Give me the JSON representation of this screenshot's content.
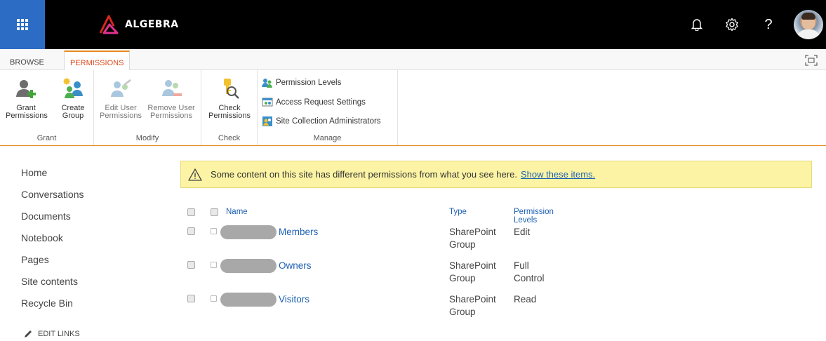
{
  "suitebar": {
    "brand": "ALGEBRA",
    "brand_colors": {
      "accent_red": "#d8281f",
      "accent_pink": "#e0328c"
    },
    "icons": [
      "waffle-icon",
      "bell-icon",
      "gear-icon",
      "help-icon",
      "avatar"
    ],
    "help_glyph": "?"
  },
  "ribbon": {
    "tabs": [
      {
        "label": "BROWSE",
        "active": false
      },
      {
        "label": "PERMISSIONS",
        "active": true
      }
    ],
    "groups": {
      "grant": {
        "label": "Grant",
        "buttons": [
          {
            "line1": "Grant",
            "line2": "Permissions",
            "icon": "grant-permissions-icon"
          },
          {
            "line1": "Create",
            "line2": "Group",
            "icon": "create-group-icon"
          }
        ]
      },
      "modify": {
        "label": "Modify",
        "buttons": [
          {
            "line1": "Edit User",
            "line2": "Permissions",
            "icon": "edit-user-permissions-icon"
          },
          {
            "line1": "Remove User",
            "line2": "Permissions",
            "icon": "remove-user-permissions-icon"
          }
        ]
      },
      "check": {
        "label": "Check",
        "buttons": [
          {
            "line1": "Check",
            "line2": "Permissions",
            "icon": "check-permissions-icon"
          }
        ]
      },
      "manage": {
        "label": "Manage",
        "items": [
          {
            "label": "Permission Levels",
            "icon": "permission-levels-icon"
          },
          {
            "label": "Access Request Settings",
            "icon": "access-request-icon"
          },
          {
            "label": "Site Collection Administrators",
            "icon": "site-admins-icon"
          }
        ]
      }
    }
  },
  "leftnav": {
    "items": [
      "Home",
      "Conversations",
      "Documents",
      "Notebook",
      "Pages",
      "Site contents",
      "Recycle Bin"
    ],
    "edit_links": "EDIT LINKS"
  },
  "banner": {
    "text": "Some content on this site has different permissions from what you see here.",
    "link": "Show these items."
  },
  "table": {
    "headers": {
      "name": "Name",
      "type": "Type",
      "permission_levels": "Permission Levels"
    },
    "rows": [
      {
        "name": "Members",
        "type_line1": "SharePoint",
        "type_line2": "Group",
        "permission": "Edit"
      },
      {
        "name": "Owners",
        "type_line1": "SharePoint",
        "type_line2": "Group",
        "permission": "Full Control"
      },
      {
        "name": "Visitors",
        "type_line1": "SharePoint",
        "type_line2": "Group",
        "permission": "Read"
      }
    ]
  },
  "colors": {
    "suitebar_bg": "#000000",
    "waffle_bg": "#2c6cc4",
    "active_tab_text": "#d84a1b",
    "ribbon_accent": "#e78b1f",
    "link": "#1e61b3",
    "banner_bg": "#fcf4a4"
  }
}
